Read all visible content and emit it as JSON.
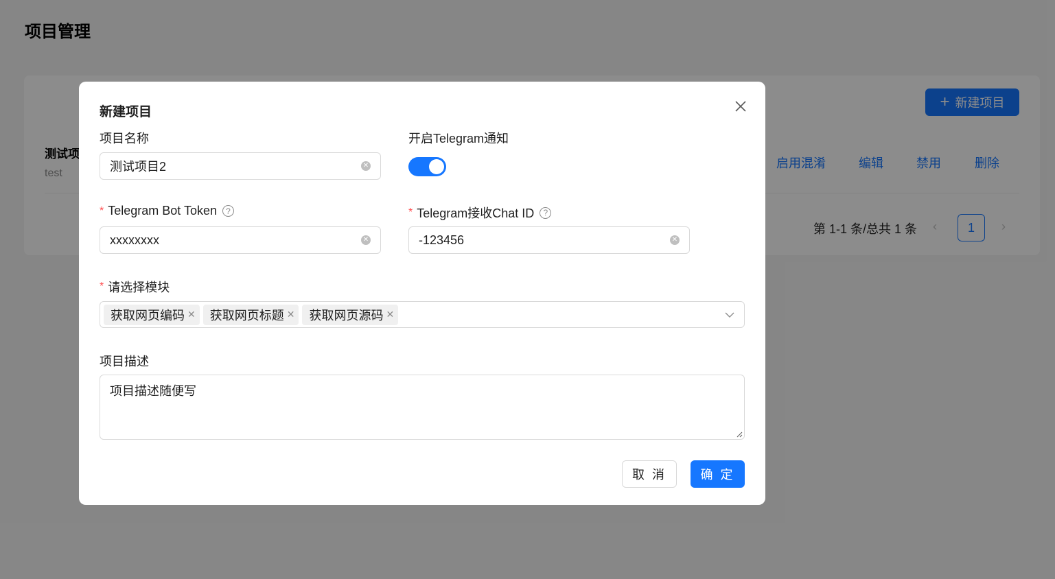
{
  "page": {
    "title": "项目管理",
    "new_button_label": "新建项目",
    "project_row": {
      "name": "测试项",
      "description": "test",
      "actions": [
        "启用混淆",
        "编辑",
        "禁用",
        "删除"
      ]
    },
    "pagination": {
      "total_text": "第 1-1 条/总共 1 条",
      "current_page": "1"
    }
  },
  "modal": {
    "title": "新建项目",
    "fields": {
      "project_name": {
        "label": "项目名称",
        "value": "测试项目2"
      },
      "telegram_notify": {
        "label": "开启Telegram通知",
        "enabled": true
      },
      "bot_token": {
        "label": "Telegram Bot Token",
        "value": "xxxxxxxx",
        "required": true
      },
      "chat_id": {
        "label": "Telegram接收Chat ID",
        "value": "-123456",
        "required": true
      },
      "modules": {
        "label": "请选择模块",
        "required": true,
        "selected": [
          "获取网页编码",
          "获取网页标题",
          "获取网页源码"
        ]
      },
      "description": {
        "label": "项目描述",
        "value": "项目描述随便写"
      }
    },
    "buttons": {
      "cancel": "取 消",
      "ok": "确 定"
    }
  },
  "colors": {
    "primary": "#1677ff",
    "required": "#ff4d4f",
    "mask": "rgba(0,0,0,0.45)"
  },
  "icons": [
    "plus-icon",
    "close-icon",
    "help-icon",
    "clear-icon",
    "tag-close-icon",
    "chevron-down-icon",
    "left-arrow-icon",
    "right-arrow-icon"
  ]
}
